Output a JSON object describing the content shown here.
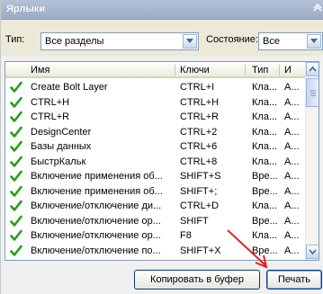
{
  "panel": {
    "title": "Ярлыки",
    "collapse_glyph": "⌃"
  },
  "filters": {
    "type_label": "Тип:",
    "type_value": "Все разделы",
    "state_label": "Состояние:",
    "state_value": "Все"
  },
  "columns": [
    "Имя",
    "Ключи",
    "Тип",
    "И"
  ],
  "rows": [
    {
      "name": "Create Bolt Layer",
      "keys": "CTRL+I",
      "type": "Кла...",
      "extra": "А..."
    },
    {
      "name": "CTRL+H",
      "keys": "CTRL+H",
      "type": "Кла...",
      "extra": "А..."
    },
    {
      "name": "CTRL+R",
      "keys": "CTRL+R",
      "type": "Кла...",
      "extra": "А..."
    },
    {
      "name": "DesignCenter",
      "keys": "CTRL+2",
      "type": "Кла...",
      "extra": "А..."
    },
    {
      "name": "Базы данных",
      "keys": "CTRL+6",
      "type": "Кла...",
      "extra": "А..."
    },
    {
      "name": "БыстрКальк",
      "keys": "CTRL+8",
      "type": "Кла...",
      "extra": "А..."
    },
    {
      "name": "Включение применения об...",
      "keys": "SHIFT+S",
      "type": "Вре...",
      "extra": "А..."
    },
    {
      "name": "Включение применения об...",
      "keys": "SHIFT+;",
      "type": "Вре...",
      "extra": "А..."
    },
    {
      "name": "Включение/отключение ди...",
      "keys": "CTRL+D",
      "type": "Кла...",
      "extra": "А..."
    },
    {
      "name": "Включение/отключение ор...",
      "keys": "SHIFT",
      "type": "Вре...",
      "extra": "А..."
    },
    {
      "name": "Включение/отключение ор...",
      "keys": "F8",
      "type": "Кла...",
      "extra": "А..."
    },
    {
      "name": "Включение/отключение по...",
      "keys": "SHIFT+X",
      "type": "Вре...",
      "extra": "А..."
    }
  ],
  "buttons": {
    "copy": "Копировать в буфер",
    "print": "Печать"
  },
  "colors": {
    "check": "#2a9a1e",
    "annotation_arrow": "#e02020"
  }
}
